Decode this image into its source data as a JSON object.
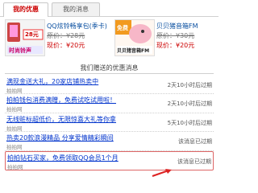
{
  "tabs": {
    "active": "我的优惠",
    "inactive": "我的消息"
  },
  "promos": [
    {
      "title": "QQ炫铃畅享包(季卡)",
      "price_old": "原价：¥28元",
      "price_new": "现价：¥20元",
      "thumb_big": "28元",
      "thumb_small": "时尚铃声"
    },
    {
      "title": "贝贝猪音箱FM",
      "price_old": "原价：¥30元",
      "price_new": "现价：¥20元",
      "thumb_big": "免费",
      "thumb_small": "贝贝猪音箱FM"
    }
  ],
  "section_title": "我们赠送的优惠消息",
  "items": [
    {
      "title": "满现金送大礼，20家店铺热卖中",
      "sub": "拍拍网",
      "status": "2天10小时后过期"
    },
    {
      "title": "拍拍钱包消费满赠，免费试吃试用啦！",
      "sub": "拍拍网",
      "status": "2天10小时后过期"
    },
    {
      "title": "无线赃标超低价，无限惊喜大礼等你拿",
      "sub": "拍拍网",
      "status": "5天10小时后过期"
    },
    {
      "title": "热卖20款浪漫精品 分享爱情精彩瞬间",
      "sub": "拍拍网",
      "status": "该消息已过期"
    },
    {
      "title": "拍拍钻石买家，免费领取QQ会员1个月",
      "sub": "拍拍网",
      "status": "该消息已过期"
    }
  ]
}
